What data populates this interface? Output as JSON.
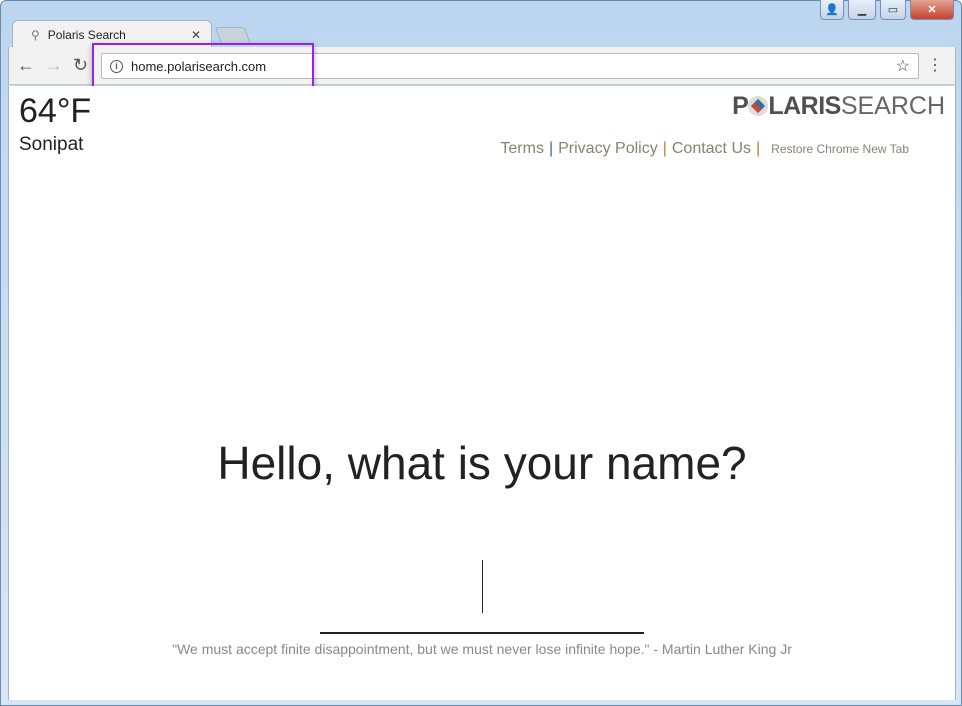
{
  "browser": {
    "tab_title": "Polaris Search",
    "url": "home.polarisearch.com"
  },
  "weather": {
    "temperature": "64°F",
    "city": "Sonipat"
  },
  "logo": {
    "bold": "P",
    "bold2": "LARIS",
    "light": "SEARCH"
  },
  "links": [
    "Terms",
    "Privacy Policy",
    "Contact Us",
    "Restore Chrome New Tab"
  ],
  "greeting": "Hello, what is your name?",
  "name_input": {
    "value": ""
  },
  "quote": "\"We must accept finite disappointment, but we must never lose infinite hope.\" - Martin Luther King Jr",
  "colors": {
    "highlight": "#9b1fe8",
    "separator_blue": "#3a6aa8",
    "separator_orange": "#c87a1e"
  }
}
